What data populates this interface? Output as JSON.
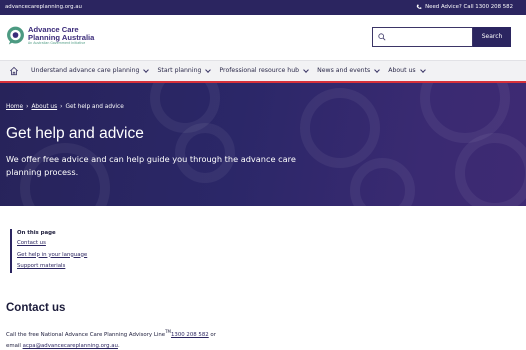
{
  "topbar": {
    "domain": "advancecareplanning.org.au",
    "advice_text": "Need Advice? Call 1300 208 582"
  },
  "logo": {
    "line1": "Advance Care",
    "line2": "Planning Australia",
    "line3": "An Australian Government Initiative"
  },
  "search": {
    "placeholder": "",
    "button_label": "Search"
  },
  "nav": {
    "items": [
      {
        "label": "Understand advance care planning"
      },
      {
        "label": "Start planning"
      },
      {
        "label": "Professional resource hub"
      },
      {
        "label": "News and events"
      },
      {
        "label": "About us"
      }
    ]
  },
  "breadcrumb": {
    "home": "Home",
    "sep1": "›",
    "about": "About us",
    "sep2": "›",
    "current": "Get help and advice"
  },
  "hero": {
    "title": "Get help and advice",
    "subtitle": "We offer free advice and can help guide you through the advance care planning process."
  },
  "on_this_page": {
    "title": "On this page",
    "links": [
      "Contact us",
      "Get help in your language",
      "Support materials"
    ]
  },
  "contact": {
    "heading": "Contact us",
    "text1": "Call the free National Advance Care Planning Advisory Line",
    "tm": "TM",
    "phone": "1300 208 582",
    "text2": " or",
    "text3": "email ",
    "email": "acpa@advancecareplanning.org.au",
    "text4": "."
  },
  "colors": {
    "brand_navy": "#2b2560",
    "accent_red": "#d7313b",
    "logo_teal": "#4c9a82"
  },
  "icons": [
    "phone-icon",
    "search-icon",
    "home-icon",
    "chevron-down-icon",
    "quote-bubble-icon"
  ]
}
